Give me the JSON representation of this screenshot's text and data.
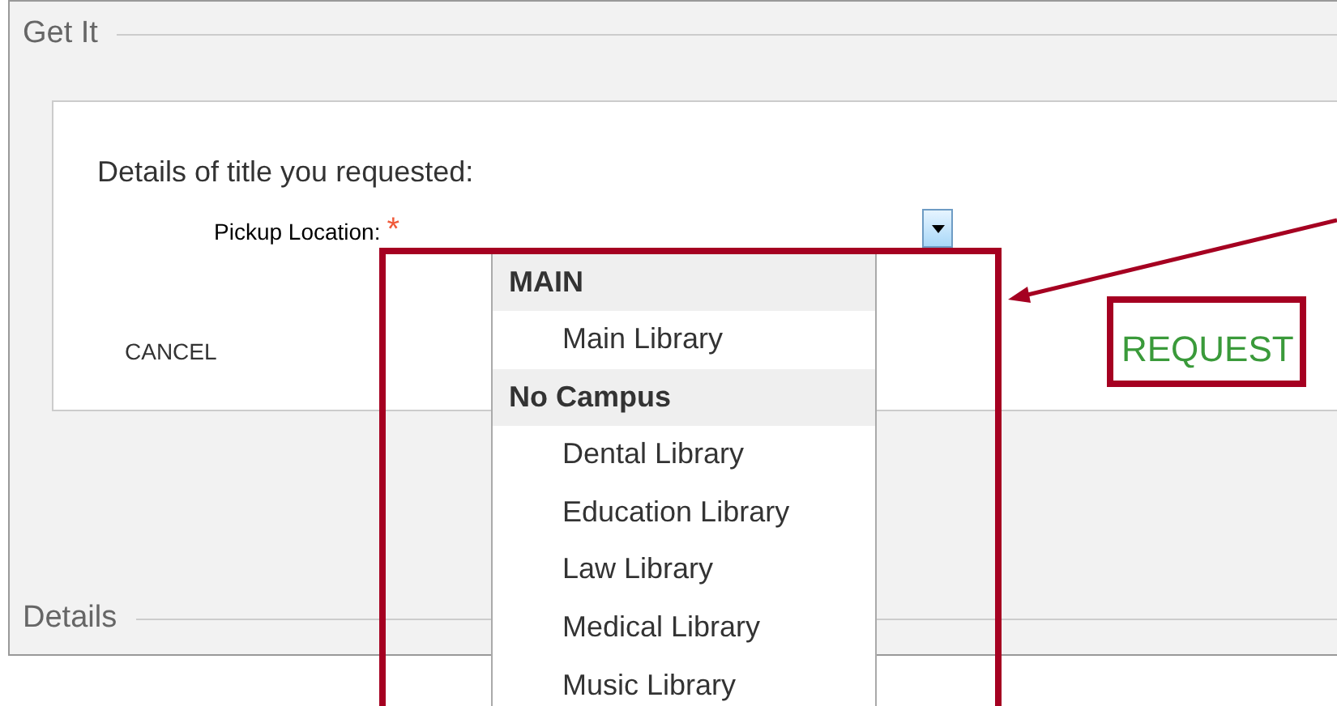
{
  "sections": [
    {
      "legend": "Get It"
    },
    {
      "legend": "Details"
    }
  ],
  "form": {
    "heading": "Details of title you requested:",
    "pickup_label": "Pickup Location:",
    "required_mark": "*",
    "cancel": "CANCEL",
    "request": "REQUEST"
  },
  "dropdown": {
    "items": [
      {
        "kind": "group",
        "label": "MAIN"
      },
      {
        "kind": "option",
        "label": "Main Library"
      },
      {
        "kind": "group",
        "label": "No Campus"
      },
      {
        "kind": "option",
        "label": "Dental Library"
      },
      {
        "kind": "option",
        "label": "Education Library"
      },
      {
        "kind": "option",
        "label": "Law Library"
      },
      {
        "kind": "option",
        "label": "Medical Library"
      },
      {
        "kind": "option",
        "label": "Music Library"
      }
    ]
  }
}
